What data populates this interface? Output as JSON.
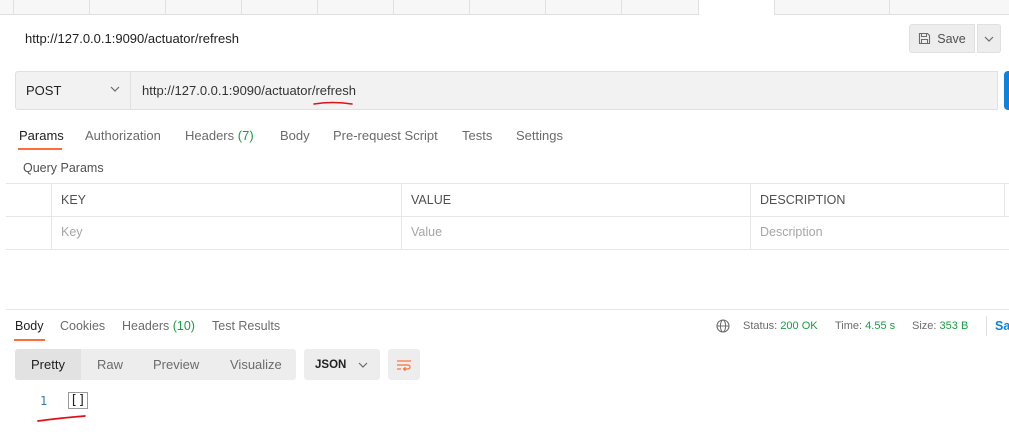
{
  "header": {
    "title": "http://127.0.0.1:9090/actuator/refresh",
    "save_label": "Save"
  },
  "request": {
    "method": "POST",
    "url": "http://127.0.0.1:9090/actuator/refresh"
  },
  "request_tabs": [
    {
      "label": "Params"
    },
    {
      "label": "Authorization"
    },
    {
      "label": "Headers",
      "count": "(7)"
    },
    {
      "label": "Body"
    },
    {
      "label": "Pre-request Script"
    },
    {
      "label": "Tests"
    },
    {
      "label": "Settings"
    }
  ],
  "query_params": {
    "label": "Query Params",
    "columns": [
      "KEY",
      "VALUE",
      "DESCRIPTION"
    ],
    "placeholders": [
      "Key",
      "Value",
      "Description"
    ]
  },
  "response_tabs": [
    {
      "label": "Body"
    },
    {
      "label": "Cookies"
    },
    {
      "label": "Headers",
      "count": "(10)"
    },
    {
      "label": "Test Results"
    }
  ],
  "response_meta": {
    "status_label": "Status:",
    "status_value": "200 OK",
    "time_label": "Time:",
    "time_value": "4.55 s",
    "size_label": "Size:",
    "size_value": "353 B",
    "save_label": "Sa"
  },
  "view_modes": [
    "Pretty",
    "Raw",
    "Preview",
    "Visualize"
  ],
  "format": "JSON",
  "body": {
    "line_number": "1",
    "content": "[]"
  },
  "colors": {
    "accent": "#ff6c37",
    "success": "#1a9c45",
    "link": "#0a84e0",
    "annotation": "#e0101a"
  }
}
